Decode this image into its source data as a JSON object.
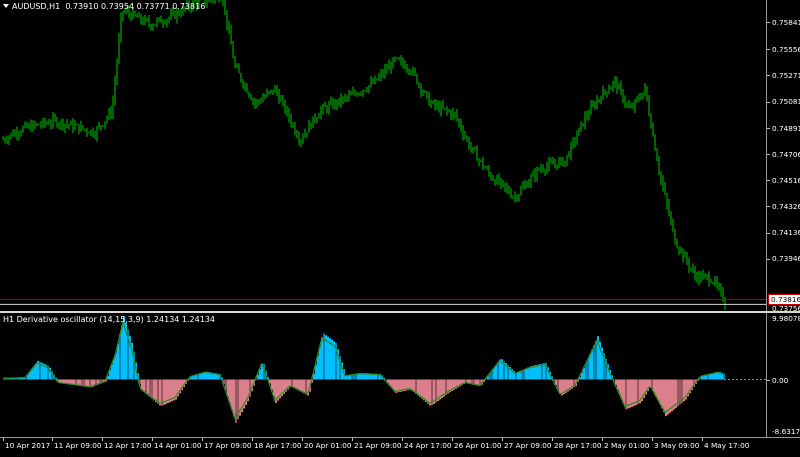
{
  "chart_header": {
    "menu_icon": "triangle-down-icon",
    "symbol": "AUDUSD,H1",
    "ohlc": "0.73910 0.73954 0.73771 0.73816"
  },
  "indicator_header": {
    "name": "H1 Derivative oscillator (14,15,3,9)",
    "values": "1.24134 1.24134"
  },
  "price_axis": {
    "ticks": [
      "0.75841",
      "0.75556",
      "0.75271",
      "0.75081",
      "0.74891",
      "0.74706",
      "0.74516",
      "0.74326",
      "0.74136",
      "0.73946",
      "0.73756"
    ],
    "current_price": "0.73816"
  },
  "oscillator_axis": {
    "max": "9.98078",
    "zero": "0.00",
    "min": "-8.63171"
  },
  "time_axis": {
    "labels": [
      "10 Apr 2017",
      "11 Apr 09:00",
      "12 Apr 17:00",
      "14 Apr 01:00",
      "17 Apr 09:00",
      "18 Apr 17:00",
      "20 Apr 01:00",
      "21 Apr 09:00",
      "24 Apr 17:00",
      "26 Apr 01:00",
      "27 Apr 09:00",
      "28 Apr 17:00",
      "2 May 01:00",
      "3 May 09:00",
      "4 May 17:00"
    ]
  },
  "colors": {
    "bullish_candle": "#00c800",
    "price_line": "#c00000",
    "histogram_positive": "#00bfff",
    "histogram_negative": "#dc7f8c",
    "signal_line": "#2e8b22",
    "bar_divider": "#000000"
  },
  "chart_data": [
    {
      "type": "line",
      "series": [
        {
          "name": "AUDUSD,H1",
          "x": [
            "10 Apr 2017",
            "11 Apr 09:00",
            "12 Apr 17:00",
            "14 Apr 01:00",
            "17 Apr 09:00",
            "18 Apr 17:00",
            "20 Apr 01:00",
            "21 Apr 09:00",
            "24 Apr 17:00",
            "26 Apr 01:00",
            "27 Apr 09:00",
            "28 Apr 17:00",
            "2 May 01:00",
            "3 May 09:00",
            "4 May 17:00"
          ],
          "y": [
            0.7495,
            0.7508,
            0.7585,
            0.7572,
            0.7582,
            0.752,
            0.7495,
            0.754,
            0.756,
            0.7505,
            0.7455,
            0.748,
            0.7528,
            0.7505,
            0.7382
          ]
        }
      ],
      "ylim": [
        0.73756,
        0.75921
      ],
      "grid": false
    },
    {
      "type": "bar",
      "series": [
        {
          "name": "H1 Derivative oscillator",
          "x": [
            "10 Apr 2017",
            "11 Apr 09:00",
            "12 Apr 17:00",
            "14 Apr 01:00",
            "17 Apr 09:00",
            "18 Apr 17:00",
            "20 Apr 01:00",
            "21 Apr 09:00",
            "24 Apr 17:00",
            "26 Apr 01:00",
            "27 Apr 09:00",
            "28 Apr 17:00",
            "2 May 01:00",
            "3 May 09:00",
            "4 May 17:00"
          ],
          "y": [
            0.3,
            2.8,
            9.5,
            -4.5,
            1.2,
            2.8,
            7.0,
            0.6,
            -2.5,
            -3.8,
            3.2,
            -1.5,
            6.5,
            -4.5,
            1.2
          ]
        }
      ],
      "ylim": [
        -8.63171,
        9.98078
      ],
      "grid": false
    }
  ]
}
